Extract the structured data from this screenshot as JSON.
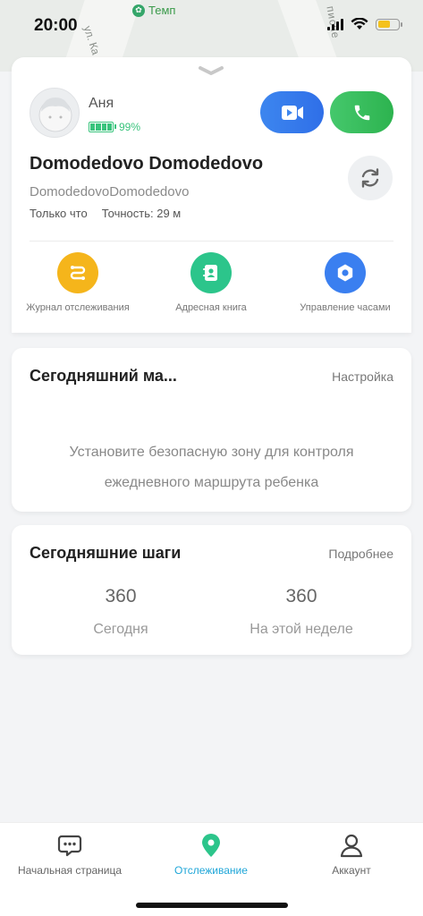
{
  "status_bar": {
    "time": "20:00"
  },
  "map": {
    "place_label": "Темп",
    "street_a": "ул. Ка",
    "street_b": "писче"
  },
  "profile": {
    "name": "Аня",
    "battery_percent": "99%",
    "battery_level": 0.99
  },
  "location": {
    "title": "Domodedovo Domodedovo",
    "subtitle": "DomodedovoDomodedovo",
    "updated": "Только что",
    "accuracy": "Точность: 29 м"
  },
  "quick_actions": [
    {
      "label": "Журнал отслеживания",
      "color": "#f5b51b",
      "icon": "route-icon"
    },
    {
      "label": "Адресная книга",
      "color": "#2cc58b",
      "icon": "contacts-icon"
    },
    {
      "label": "Управление часами",
      "color": "#3a7ff0",
      "icon": "settings-icon"
    }
  ],
  "route_card": {
    "title": "Сегодняшний ма...",
    "link": "Настройка",
    "message_line1": "Установите безопасную зону для контроля",
    "message_line2": "ежедневного маршрута ребенка"
  },
  "steps_card": {
    "title": "Сегодняшние шаги",
    "link": "Подробнее",
    "today_value": "360",
    "today_label": "Сегодня",
    "week_value": "360",
    "week_label": "На этой неделе"
  },
  "tabs": [
    {
      "label": "Начальная страница",
      "active": false
    },
    {
      "label": "Отслеживание",
      "active": true
    },
    {
      "label": "Аккаунт",
      "active": false
    }
  ],
  "colors": {
    "accent": "#1fa6d8",
    "video_button": "#3d86ef",
    "call_button": "#45c86c",
    "battery": "#3ac47d"
  }
}
